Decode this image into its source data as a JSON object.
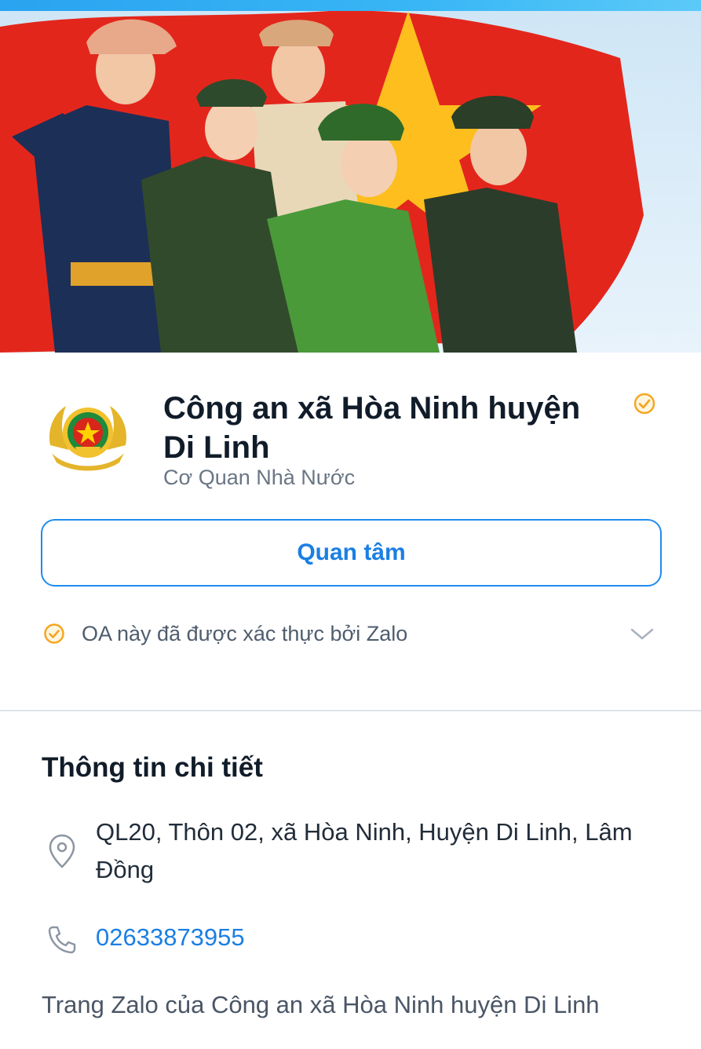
{
  "profile": {
    "name": "Công an xã Hòa Ninh huyện Di Linh",
    "category": "Cơ Quan Nhà Nước",
    "follow_label": "Quan tâm",
    "verified_text": "OA này đã được xác thực bởi Zalo"
  },
  "details": {
    "title": "Thông tin chi tiết",
    "address": "QL20, Thôn 02, xã Hòa Ninh, Huyện Di Linh, Lâm Đồng",
    "phone": "02633873955",
    "description": "Trang Zalo của Công an xã Hòa Ninh huyện Di Linh"
  },
  "icons": {
    "verified": "check-circle-icon",
    "expand": "chevron-down-icon",
    "address": "location-pin-icon",
    "phone": "phone-icon"
  },
  "colors": {
    "accent": "#1b7fe3",
    "verified_badge": "#f5a623",
    "flag_red": "#e3261c",
    "star_yellow": "#ffd200"
  }
}
